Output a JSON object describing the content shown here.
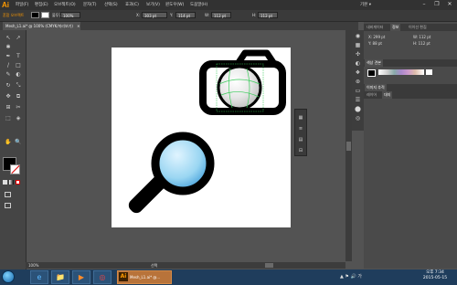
{
  "app": {
    "logo": "Ai",
    "menus": [
      "파일(F)",
      "편집(E)",
      "오브젝트(O)",
      "문자(T)",
      "선택(S)",
      "효과(C)",
      "보기(V)",
      "윈도우(W)",
      "도움말(H)"
    ],
    "workspace": "기본 ▾",
    "window_buttons": [
      "–",
      "❐",
      "✕"
    ]
  },
  "control_bar": {
    "selection_label": "혼합 오브젝트",
    "opacity_label": "불투명도:",
    "opacity_value": "100%",
    "x_label": "X:",
    "x_value": "303 pt",
    "y_label": "Y:",
    "y_value": "114 pt",
    "w_label": "W:",
    "w_value": "112 pt",
    "h_label": "H:",
    "h_value": "112 pt"
  },
  "document": {
    "tab_title": "Mesh_L1.ai* @ 100% (CMYK/미리보기)",
    "tab_close": "✕"
  },
  "tools": [
    "↖",
    "↗",
    "✱",
    "✒",
    "T",
    "/",
    "□",
    "✎",
    "◐",
    "↻",
    "⤡",
    "✥",
    "⧉",
    "⊞",
    "✂",
    "⬚",
    "◈",
    "✋",
    "🔍"
  ],
  "floating_panel_icons": [
    "▦",
    "≡",
    "▤",
    "⊟"
  ],
  "right_strip_icons": [
    "◉",
    "▦",
    "✣",
    "◐",
    "❖",
    "⊛",
    "▭",
    "☰",
    "⬤",
    "◎"
  ],
  "right_panels": {
    "transform_tabs": [
      "내비게이터",
      "정보",
      "이이선 편집"
    ],
    "info": {
      "x": "X: 299 pt",
      "y": "Y: 88 pt",
      "w": "W: 112 pt",
      "h": "H: 112 pt"
    },
    "color_tabs": [
      "색상 견본"
    ],
    "layers_tabs": [
      "이미지 추적"
    ],
    "layers_subtabs": [
      "레이어",
      "대지"
    ]
  },
  "status": {
    "zoom": "100%",
    "tool_name": "선택"
  },
  "taskbar": {
    "apps": [
      "e",
      "📁",
      "▶",
      "◎"
    ],
    "ai_label": "Mesh_L1.ai* @...",
    "tray": "▲ ⚑ 🔊 가",
    "time": "오후 7:34",
    "date": "2015-05-15"
  },
  "colors": {
    "accent": "#ff9a00",
    "lens_gradient_inner": "#e0f4ff",
    "lens_gradient_outer": "#4aa8e8",
    "icon_stroke": "#000000",
    "mesh_lines": "#3acc5a"
  }
}
